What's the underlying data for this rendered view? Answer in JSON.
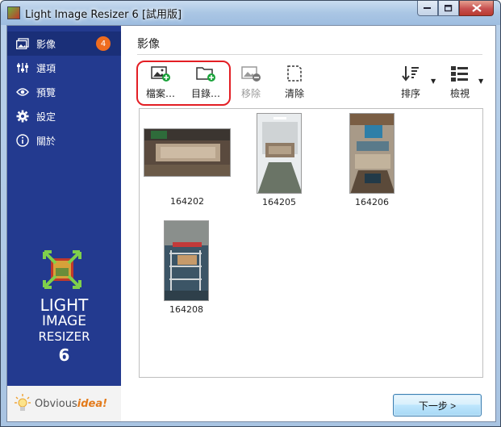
{
  "window": {
    "title": "Light Image Resizer 6 [試用版]"
  },
  "sidebar": {
    "items": [
      {
        "label": "影像",
        "icon": "images-icon",
        "badge": "4"
      },
      {
        "label": "選項",
        "icon": "sliders-icon"
      },
      {
        "label": "預覽",
        "icon": "eye-icon"
      },
      {
        "label": "設定",
        "icon": "gear-icon"
      },
      {
        "label": "關於",
        "icon": "info-icon"
      }
    ],
    "logo": {
      "line1": "LIGHT",
      "line2": "IMAGE",
      "line3": "RESIZER",
      "line4": "6"
    },
    "brand": {
      "prefix": "Obvious",
      "suffix": "idea!"
    }
  },
  "main": {
    "heading": "影像",
    "toolbar": {
      "files_label": "檔案…",
      "folder_label": "目錄…",
      "remove_label": "移除",
      "clear_label": "清除",
      "sort_label": "排序",
      "view_label": "檢視"
    },
    "thumbnails": [
      {
        "name": "164202"
      },
      {
        "name": "164205"
      },
      {
        "name": "164206"
      },
      {
        "name": "164208"
      }
    ],
    "next_label": "下一步 >"
  },
  "colors": {
    "sidebar_bg": "#233a8f",
    "badge": "#ef6c1f",
    "highlight": "#e31e24",
    "accent_green": "#1aa33a"
  }
}
